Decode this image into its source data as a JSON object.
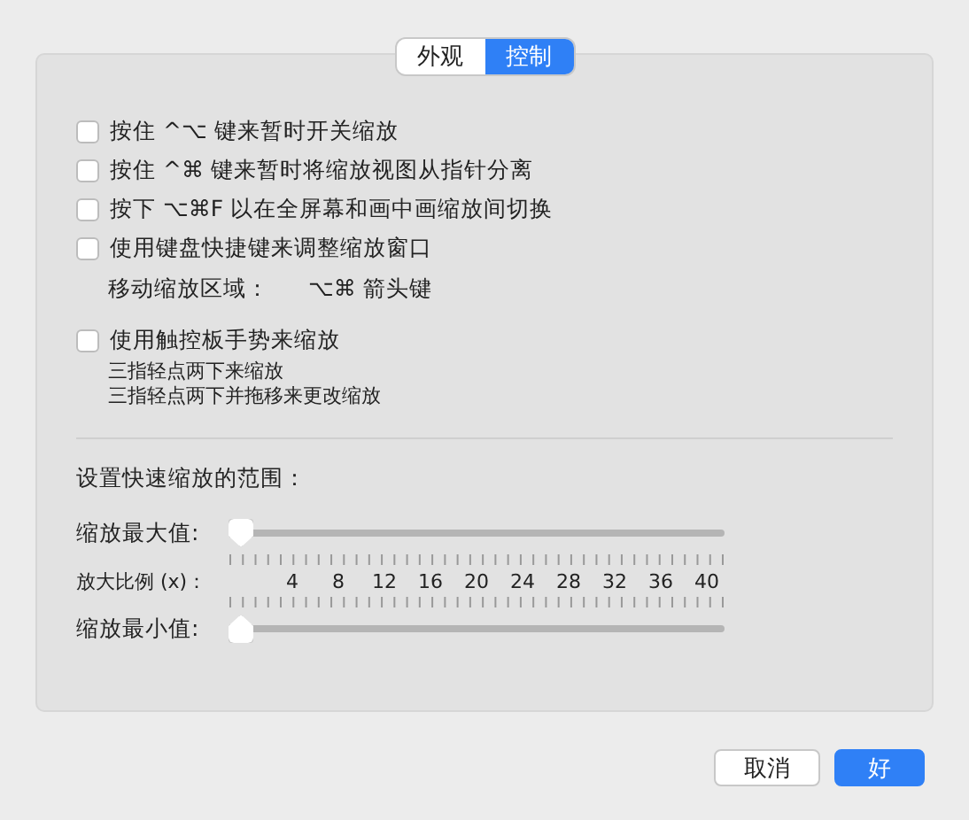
{
  "tabs": [
    {
      "label": "外观",
      "selected": false
    },
    {
      "label": "控制",
      "selected": true
    }
  ],
  "options": [
    {
      "kind": "checkbox",
      "label": "按住 ^⌥ 键来暂时开关缩放",
      "checked": false
    },
    {
      "kind": "checkbox",
      "label": "按住 ^⌘ 键来暂时将缩放视图从指针分离",
      "checked": false
    },
    {
      "kind": "checkbox",
      "label": "按下 ⌥⌘F 以在全屏幕和画中画缩放间切换",
      "checked": false
    },
    {
      "kind": "checkbox",
      "label": "使用键盘快捷键来调整缩放窗口",
      "checked": false
    },
    {
      "kind": "info",
      "label": "移动缩放区域：",
      "value": "⌥⌘ 箭头键"
    },
    {
      "kind": "checkbox",
      "label": "使用触控板手势来缩放",
      "checked": false,
      "notes": [
        "三指轻点两下来缩放",
        "三指轻点两下并拖移来更改缩放"
      ]
    }
  ],
  "range": {
    "heading": "设置快速缩放的范围：",
    "max_slider": {
      "label": "缩放最大值:",
      "level": 0
    },
    "scale_label": "放大比例 (x)：",
    "scale": [
      "4",
      "8",
      "12",
      "16",
      "20",
      "24",
      "28",
      "32",
      "36",
      "40"
    ],
    "min_slider": {
      "label": "缩放最小值:",
      "level": 0
    }
  },
  "buttons": [
    {
      "label": "取消",
      "kind": "secondary"
    },
    {
      "label": "好",
      "kind": "primary"
    }
  ]
}
